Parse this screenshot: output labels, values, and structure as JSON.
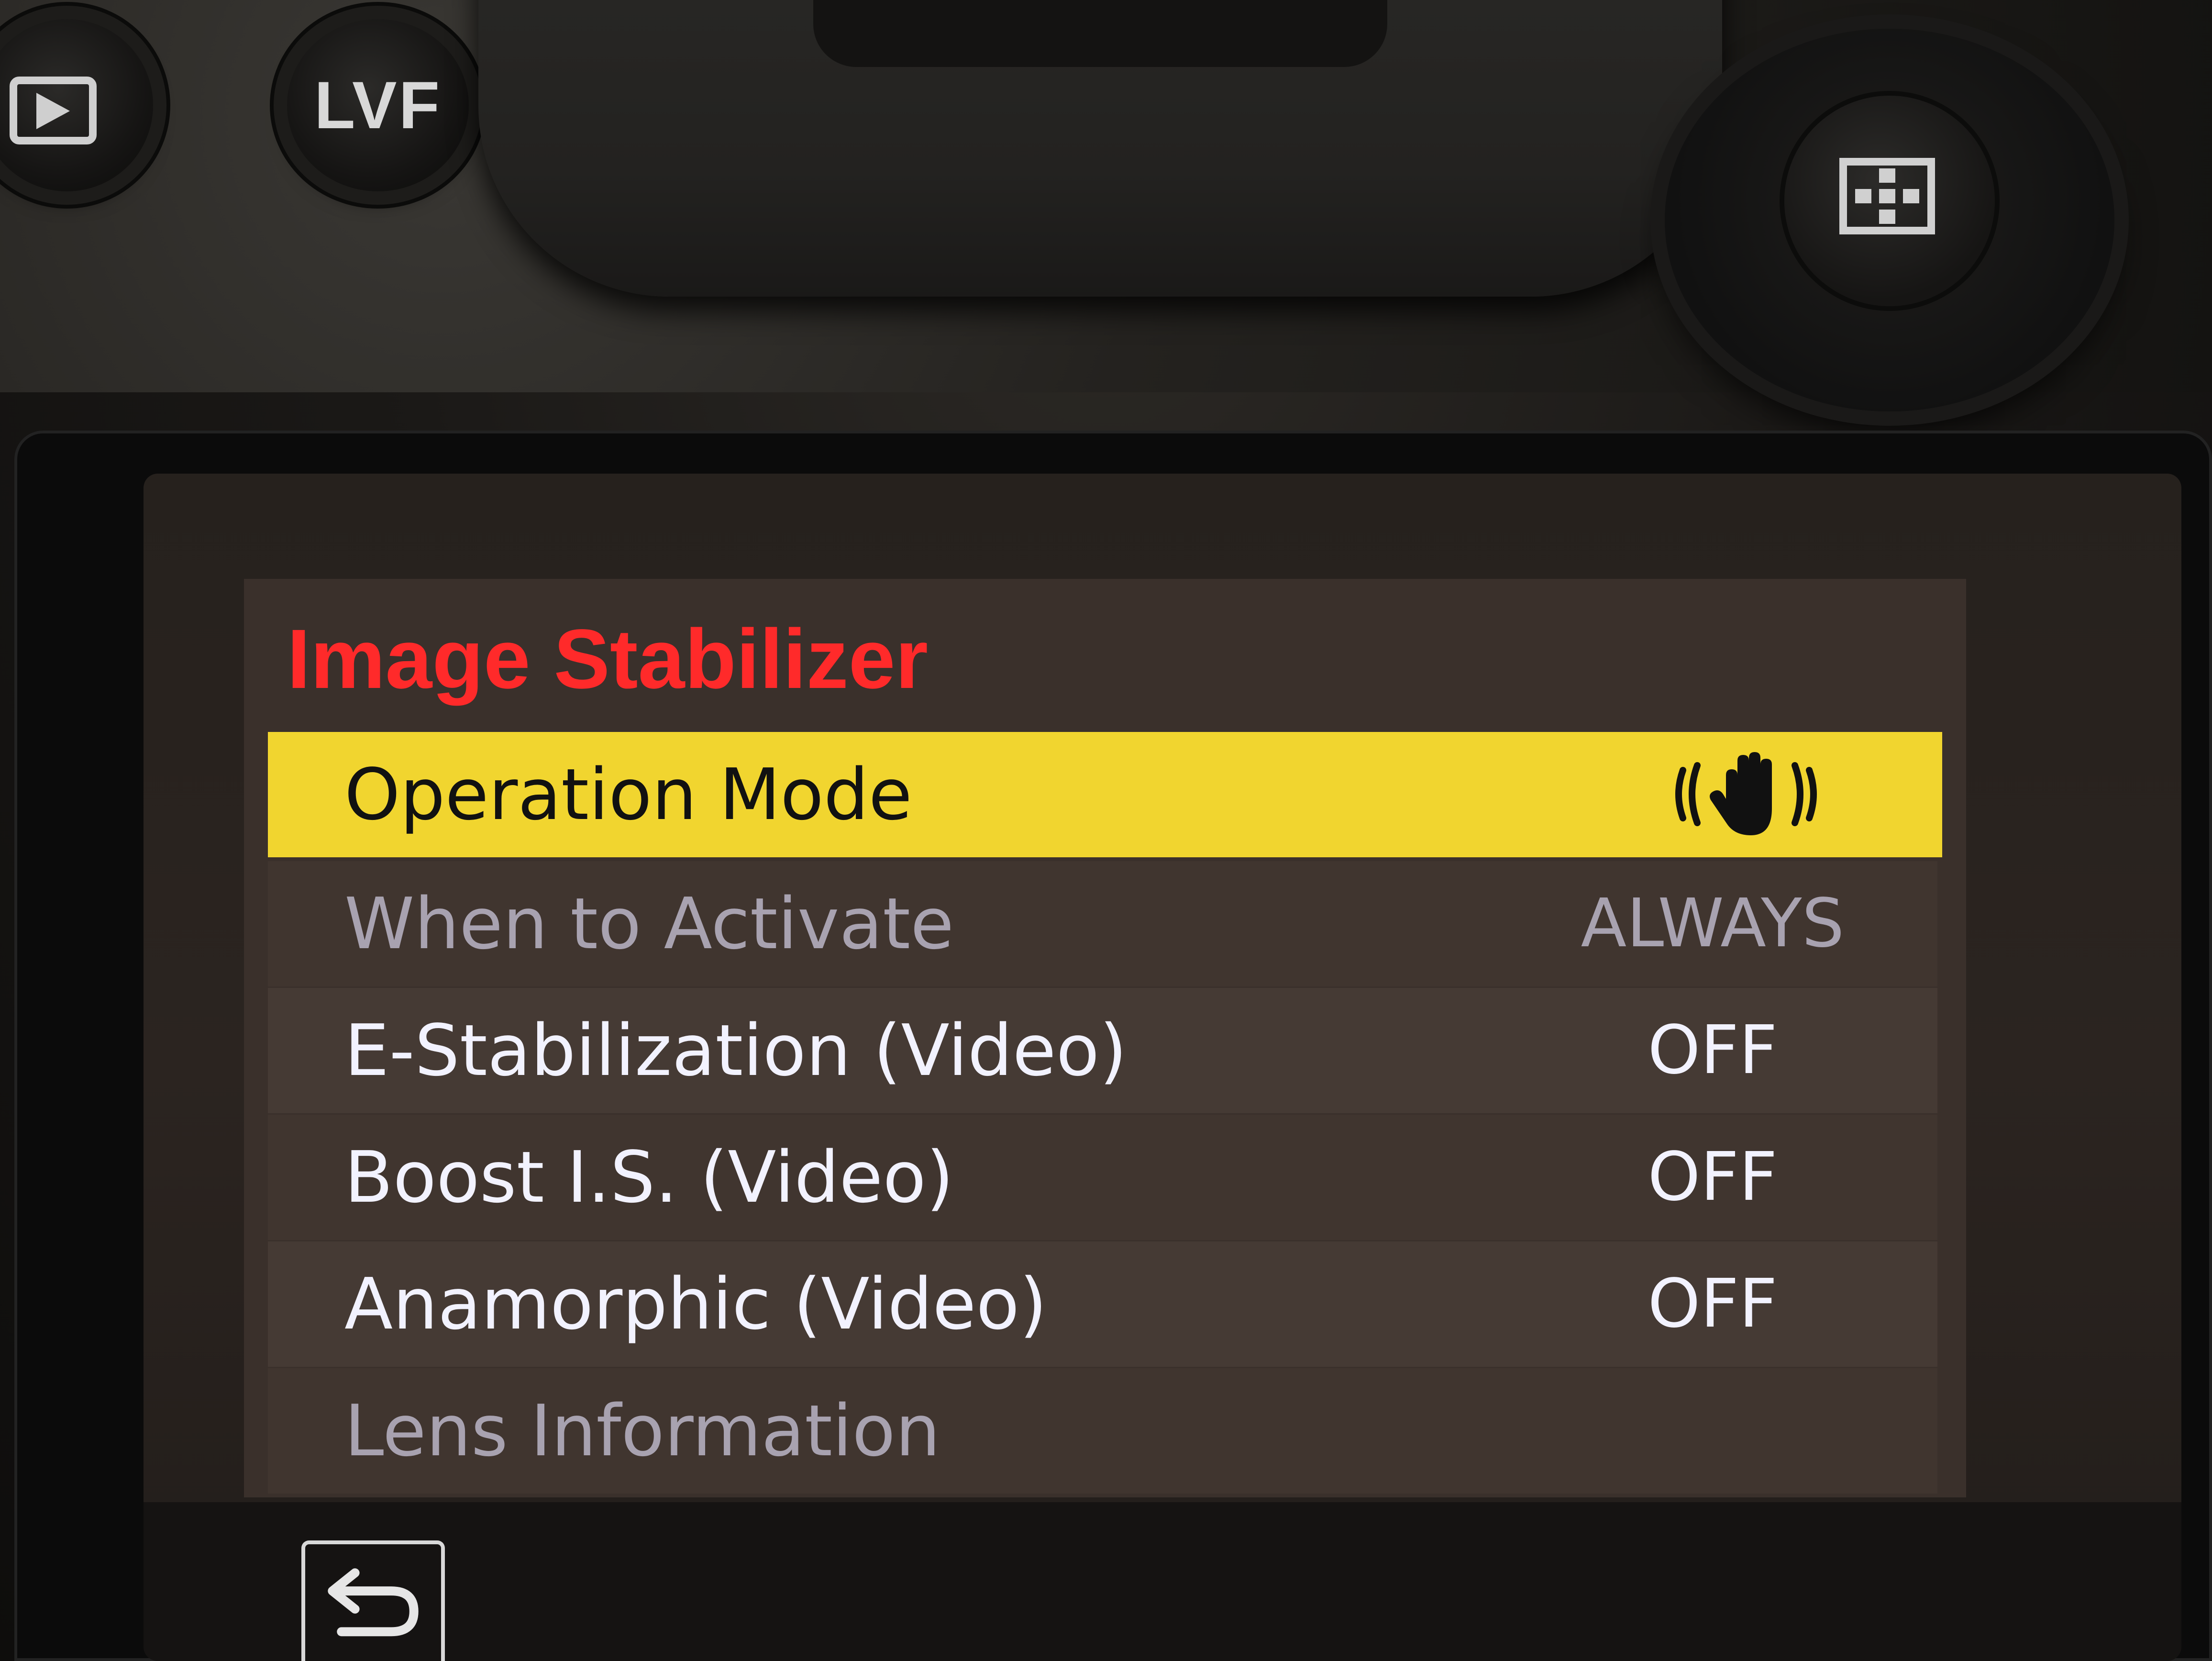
{
  "camera": {
    "buttons": {
      "lvf_label": "LVF"
    }
  },
  "menu": {
    "title": "Image Stabilizer",
    "items": [
      {
        "label": "Operation Mode",
        "value": "",
        "value_icon": "hand-shake-icon",
        "state": "selected"
      },
      {
        "label": "When to Activate",
        "value": "ALWAYS",
        "state": "disabled"
      },
      {
        "label": "E-Stabilization (Video)",
        "value": "OFF",
        "state": "enabled"
      },
      {
        "label": "Boost I.S. (Video)",
        "value": "OFF",
        "state": "enabled"
      },
      {
        "label": "Anamorphic (Video)",
        "value": "OFF",
        "state": "enabled"
      },
      {
        "label": "Lens Information",
        "value": "",
        "state": "disabled"
      }
    ]
  },
  "footer": {
    "back_icon": "return-icon"
  },
  "colors": {
    "title": "#ff2a2a",
    "selected_row": "#f1d52f",
    "enabled_text": "#f2f2ff",
    "disabled_text": "#a8a2b0",
    "panel": "#3a302b"
  }
}
